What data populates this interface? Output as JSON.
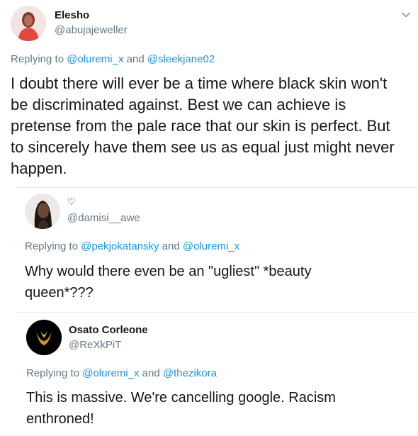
{
  "tweets": [
    {
      "name": "Elesho",
      "handle": "@abujajeweller",
      "reply_prefix": "Replying to ",
      "reply_users": [
        "@oluremi_x",
        "@sleekjane02"
      ],
      "reply_joiner": " and ",
      "text_lines": [
        "I doubt there will ever be a time where black skin won't",
        "be discriminated against. Best we can achieve is",
        "pretense from the pale race that our skin is perfect. But",
        "to sincerely have them see us as equal just might never",
        "happen."
      ]
    },
    {
      "name": "♡",
      "handle": "@damisi__awe",
      "reply_prefix": "Replying to ",
      "reply_users": [
        "@pekjokatansky",
        "@oluremi_x"
      ],
      "reply_joiner": " and ",
      "text_lines": [
        "Why would there even be an \"ugliest\" *beauty",
        "queen*???"
      ]
    },
    {
      "name": "Osato Corleone",
      "handle": "@ReXkPiT",
      "reply_prefix": "Replying to ",
      "reply_users": [
        "@oluremi_x",
        "@thezikora"
      ],
      "reply_joiner": " and ",
      "text_lines": [
        "This is massive. We're cancelling google. Racism",
        "enthroned!"
      ]
    }
  ],
  "icons": {
    "menu": "chevron-down-icon"
  },
  "colors": {
    "link": "#1b95e0",
    "muted": "#657786",
    "text": "#14171a",
    "divider": "#e6ecf0"
  }
}
